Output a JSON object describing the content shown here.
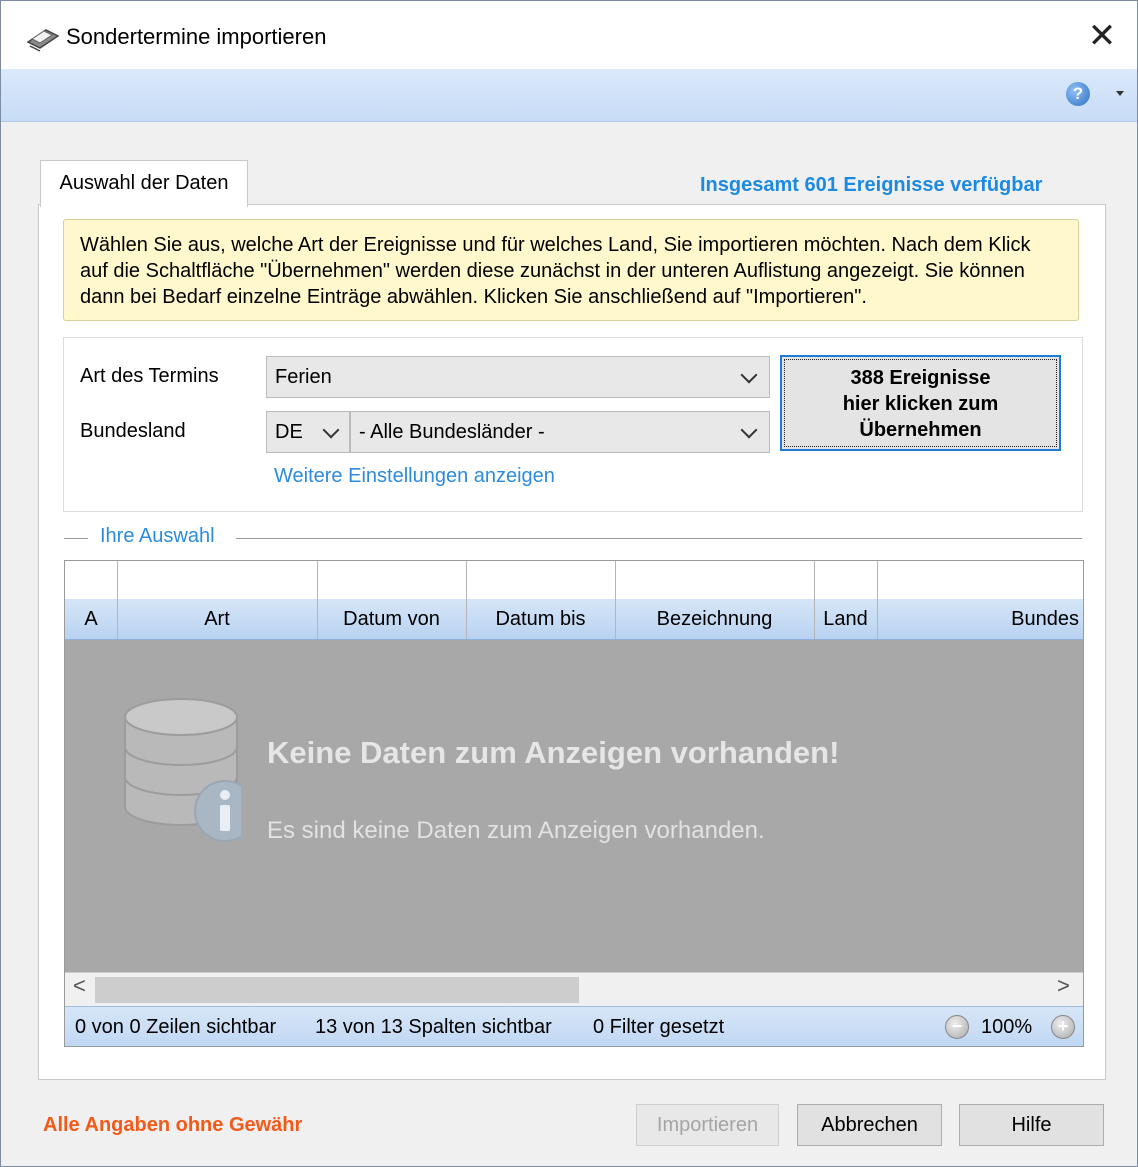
{
  "window": {
    "title": "Sondertermine importieren",
    "close_label": "✕"
  },
  "toolbar": {
    "help_icon": "help-icon",
    "help_glyph": "?"
  },
  "tabs": [
    {
      "label": "Auswahl der Daten",
      "active": true
    }
  ],
  "total_available": "Insgesamt 601 Ereignisse verfügbar",
  "info_text": "Wählen Sie aus, welche Art der Ereignisse und für welches Land, Sie importieren möchten. Nach dem Klick auf die Schaltfläche \"Übernehmen\" werden diese zunächst in der unteren Auflistung angezeigt. Sie können dann bei Bedarf einzelne Einträge abwählen. Klicken Sie anschließend auf \"Importieren\".",
  "form": {
    "art_label": "Art des Termins",
    "art_value": "Ferien",
    "bundesland_label": "Bundesland",
    "country_value": "DE",
    "state_value": "- Alle Bundesländer -",
    "apply_button_line1": "388 Ereignisse",
    "apply_button_line2": "hier klicken zum",
    "apply_button_line3": "Übernehmen",
    "more_settings_link": "Weitere Einstellungen anzeigen"
  },
  "selection": {
    "legend": "Ihre Auswahl",
    "columns": [
      "A",
      "Art",
      "Datum von",
      "Datum bis",
      "Bezeichnung",
      "Land",
      "Bundes"
    ],
    "empty_title": "Keine Daten zum Anzeigen vorhanden!",
    "empty_subtitle": "Es sind keine Daten zum Anzeigen vorhanden.",
    "scroll_left": "<",
    "scroll_right": ">",
    "status": {
      "rows_visible": "0 von 0 Zeilen sichtbar",
      "cols_visible": "13 von 13 Spalten sichtbar",
      "filters": "0 Filter gesetzt",
      "zoom": "100%",
      "zoom_out_glyph": "−",
      "zoom_in_glyph": "+"
    }
  },
  "footer": {
    "disclaimer": "Alle Angaben ohne Gewähr",
    "import_button": "Importieren",
    "cancel_button": "Abbrechen",
    "help_button": "Hilfe"
  },
  "colors": {
    "accent": "#1c8ae0",
    "disclaimer": "#f25a19",
    "info_bg": "#fff8cc",
    "grid_empty_bg": "#a8a8a8"
  }
}
